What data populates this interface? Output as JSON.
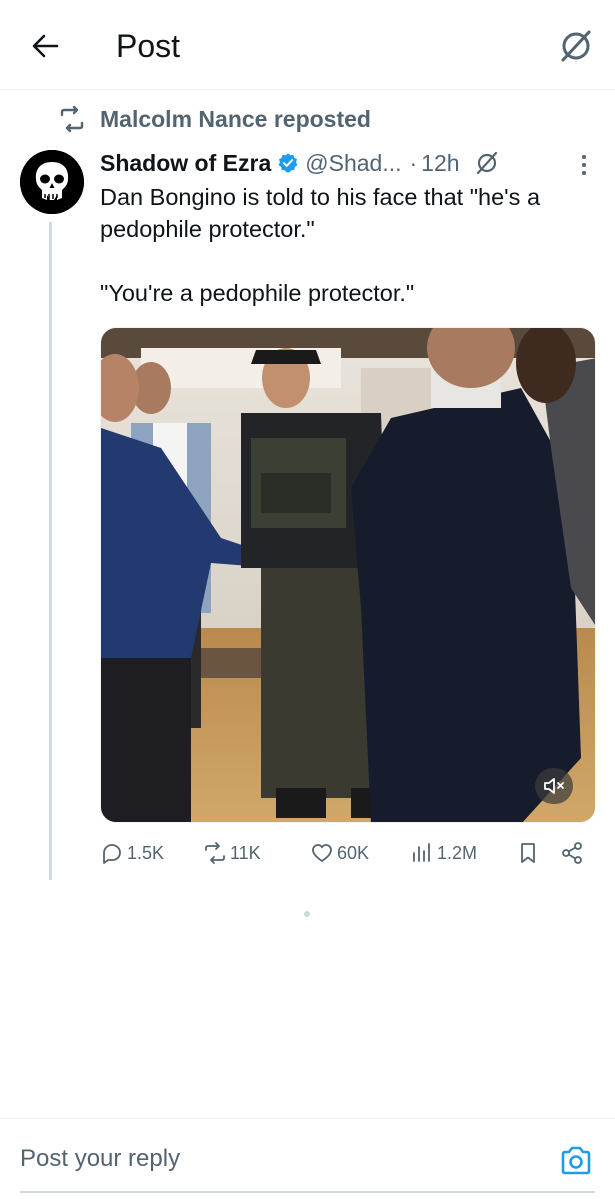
{
  "header": {
    "title": "Post",
    "back_icon": "arrow-left-icon",
    "grok_icon": "grok-icon"
  },
  "repost": {
    "icon": "repost-icon",
    "text": "Malcolm Nance reposted"
  },
  "tweet": {
    "author_name": "Shadow of Ezra",
    "verified_icon": "verified-badge-icon",
    "verified_color": "#1d9bf0",
    "handle": "@Shad...",
    "separator": "·",
    "time": "12h",
    "text_line1": "Dan Bongino is told to his face that \"he's a pedophile protector.\"",
    "text_line2": "\"You're a pedophile protector.\"",
    "media": {
      "type": "video",
      "mute_icon": "volume-muted-icon"
    },
    "stats": {
      "replies": "1.5K",
      "reposts": "11K",
      "likes": "60K",
      "views": "1.2M"
    }
  },
  "reply": {
    "placeholder": "Post your reply",
    "camera_icon": "camera-icon",
    "accent": "#1d9bf0"
  }
}
